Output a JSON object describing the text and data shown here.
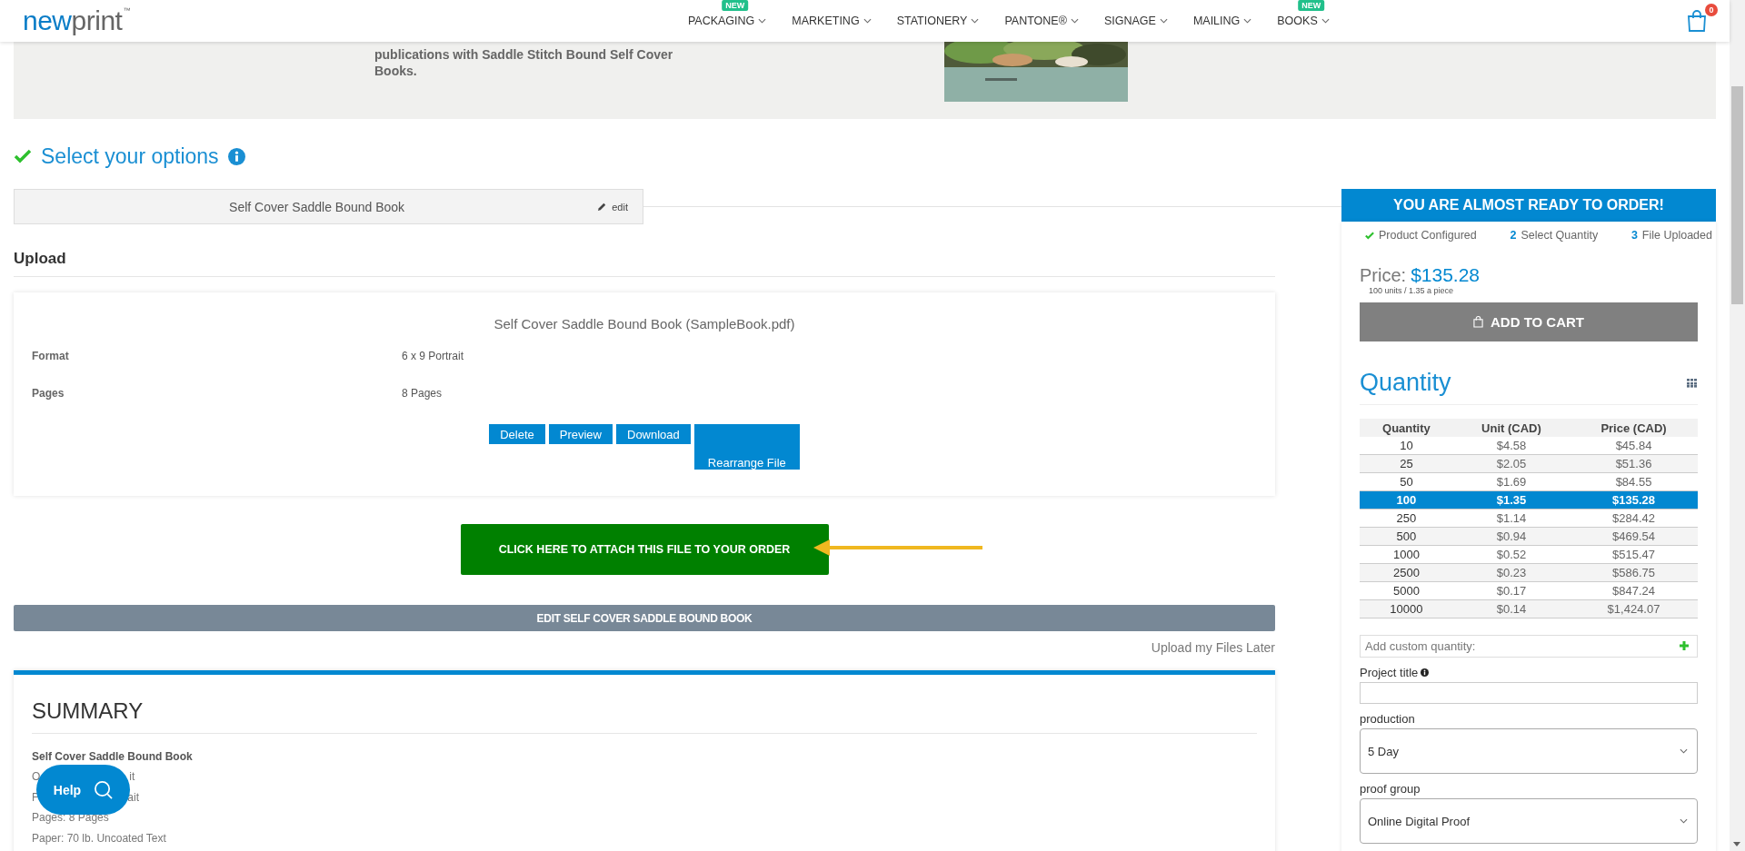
{
  "header": {
    "logo": "newprint",
    "logo_mark": "™",
    "nav": [
      {
        "label": "PACKAGING",
        "badge": "NEW"
      },
      {
        "label": "MARKETING"
      },
      {
        "label": "STATIONERY"
      },
      {
        "label": "PANTONE®"
      },
      {
        "label": "SIGNAGE"
      },
      {
        "label": "MAILING"
      },
      {
        "label": "BOOKS",
        "badge": "NEW"
      }
    ],
    "cart_count": "0"
  },
  "banner": {
    "text": "publications with Saddle Stitch Bound Self Cover Books."
  },
  "options": {
    "title": "Select your options",
    "product": "Self Cover Saddle Bound Book",
    "edit": "edit"
  },
  "upload": {
    "heading": "Upload",
    "file_title": "Self Cover Saddle Bound Book (SampleBook.pdf)",
    "specs": [
      {
        "label": "Format",
        "value": "6 x 9 Portrait"
      },
      {
        "label": "Pages",
        "value": "8 Pages"
      }
    ],
    "actions": [
      {
        "label": "Delete",
        "kind": "small"
      },
      {
        "label": "Preview",
        "kind": "small"
      },
      {
        "label": "Download",
        "kind": "small"
      },
      {
        "label": "Rearrange File",
        "kind": "tall"
      }
    ],
    "attach_button": "CLICK HERE TO ATTACH THIS FILE TO YOUR ORDER",
    "edit_button": "EDIT SELF COVER SADDLE BOUND BOOK",
    "later_link": "Upload my Files Later"
  },
  "summary": {
    "title": "SUMMARY",
    "product": "Self Cover Saddle Bound Book",
    "lines": [
      {
        "parts": [
          "O",
          "it"
        ]
      },
      {
        "parts": [
          "F",
          "ait"
        ]
      },
      {
        "parts": [
          "Pages: 8 Pages"
        ]
      },
      {
        "parts": [
          "Paper: 70 lb. Uncoated Text"
        ]
      }
    ]
  },
  "help": {
    "label": "Help"
  },
  "sidebar": {
    "banner": "YOU ARE ALMOST READY TO ORDER!",
    "steps": [
      {
        "kind": "done",
        "label": "Product Configured"
      },
      {
        "kind": "number",
        "number": "2",
        "label": "Select Quantity"
      },
      {
        "kind": "number",
        "number": "3",
        "label": "File Uploaded"
      }
    ],
    "price": {
      "label": "Price:",
      "amount": "$135.28",
      "detail": "100 units / 1.35 a piece"
    },
    "add_to_cart": "ADD TO CART",
    "quantity": {
      "title": "Quantity",
      "columns": [
        "Quantity",
        "Unit (CAD)",
        "Price (CAD)"
      ],
      "rows": [
        {
          "cells": [
            "10",
            "$4.58",
            "$45.84"
          ],
          "selected": false
        },
        {
          "cells": [
            "25",
            "$2.05",
            "$51.36"
          ],
          "selected": false
        },
        {
          "cells": [
            "50",
            "$1.69",
            "$84.55"
          ],
          "selected": false
        },
        {
          "cells": [
            "100",
            "$1.35",
            "$135.28"
          ],
          "selected": true
        },
        {
          "cells": [
            "250",
            "$1.14",
            "$284.42"
          ],
          "selected": false
        },
        {
          "cells": [
            "500",
            "$0.94",
            "$469.54"
          ],
          "selected": false
        },
        {
          "cells": [
            "1000",
            "$0.52",
            "$515.47"
          ],
          "selected": false
        },
        {
          "cells": [
            "2500",
            "$0.23",
            "$586.75"
          ],
          "selected": false
        },
        {
          "cells": [
            "5000",
            "$0.17",
            "$847.24"
          ],
          "selected": false
        },
        {
          "cells": [
            "10000",
            "$0.14",
            "$1,424.07"
          ],
          "selected": false
        }
      ]
    },
    "custom_quantity": {
      "placeholder": "Add custom quantity:"
    },
    "project_title": {
      "label": "Project title"
    },
    "selects": [
      {
        "label": "production",
        "value": "5 Day"
      },
      {
        "label": "proof group",
        "value": "Online Digital Proof"
      }
    ]
  }
}
